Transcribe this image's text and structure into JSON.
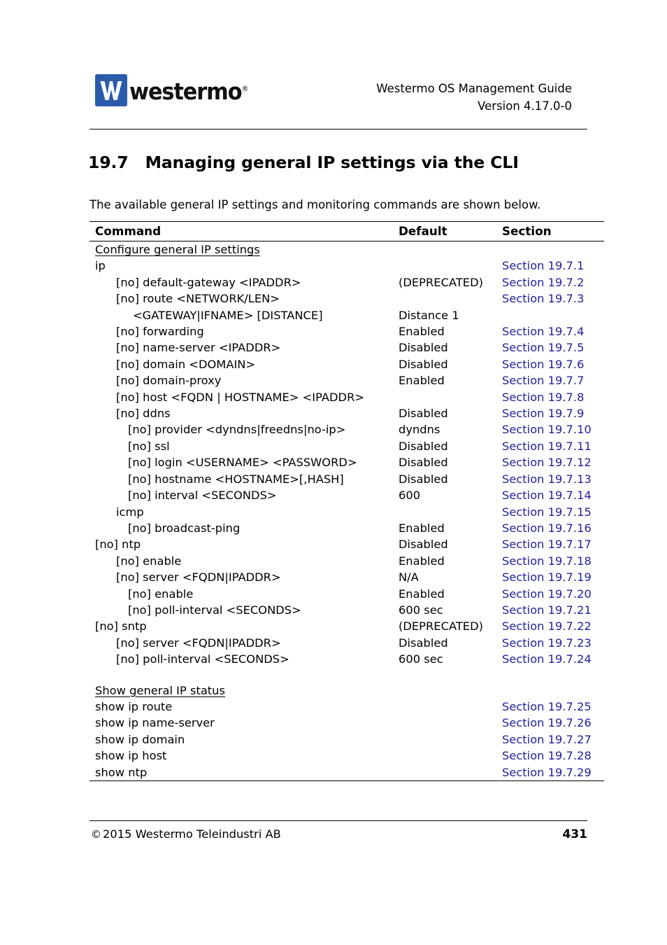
{
  "header": {
    "logo_word": "westermo",
    "logo_reg": "®",
    "doc_title": "Westermo OS Management Guide",
    "doc_version": "Version 4.17.0-0"
  },
  "section": {
    "number": "19.7",
    "title": "Managing general IP settings via the CLI",
    "intro": "The available general IP settings and monitoring commands are shown below."
  },
  "table": {
    "columns": [
      "Command",
      "Default",
      "Section"
    ],
    "groups": [
      {
        "heading": "Configure general IP settings",
        "rows": [
          {
            "level": 0,
            "command": "ip",
            "default": "",
            "section": "Section 19.7.1"
          },
          {
            "level": 1,
            "command": "[no] default-gateway <IPADDR>",
            "default": "(DEPRECATED)",
            "section": "Section 19.7.2"
          },
          {
            "level": 1,
            "command": "[no] route <NETWORK/LEN>",
            "default": "",
            "section": "Section 19.7.3"
          },
          {
            "level": 3,
            "command": "<GATEWAY|IFNAME> [DISTANCE]",
            "default": "Distance 1",
            "section": ""
          },
          {
            "level": 1,
            "command": "[no] forwarding",
            "default": "Enabled",
            "section": "Section 19.7.4"
          },
          {
            "level": 1,
            "command": "[no] name-server <IPADDR>",
            "default": "Disabled",
            "section": "Section 19.7.5"
          },
          {
            "level": 1,
            "command": "[no] domain <DOMAIN>",
            "default": "Disabled",
            "section": "Section 19.7.6"
          },
          {
            "level": 1,
            "command": "[no] domain-proxy",
            "default": "Enabled",
            "section": "Section 19.7.7"
          },
          {
            "level": 1,
            "command": "[no] host <FQDN | HOSTNAME> <IPADDR>",
            "default": "",
            "section": "Section 19.7.8"
          },
          {
            "level": 1,
            "command": "[no] ddns",
            "default": "Disabled",
            "section": "Section 19.7.9"
          },
          {
            "level": 2,
            "command": "[no] provider <dyndns|freedns|no-ip>",
            "default": "dyndns",
            "section": "Section 19.7.10"
          },
          {
            "level": 2,
            "command": "[no] ssl",
            "default": "Disabled",
            "section": "Section 19.7.11"
          },
          {
            "level": 2,
            "command": "[no] login <USERNAME> <PASSWORD>",
            "default": "Disabled",
            "section": "Section 19.7.12"
          },
          {
            "level": 2,
            "command": "[no] hostname <HOSTNAME>[,HASH]",
            "default": "Disabled",
            "section": "Section 19.7.13"
          },
          {
            "level": 2,
            "command": "[no] interval <SECONDS>",
            "default": "600",
            "section": "Section 19.7.14"
          },
          {
            "level": 1,
            "command": "icmp",
            "default": "",
            "section": "Section 19.7.15"
          },
          {
            "level": 2,
            "command": "[no] broadcast-ping",
            "default": "Enabled",
            "section": "Section 19.7.16"
          },
          {
            "level": 0,
            "command": "[no] ntp",
            "default": "Disabled",
            "section": "Section 19.7.17"
          },
          {
            "level": 1,
            "command": "[no] enable",
            "default": "Enabled",
            "section": "Section 19.7.18"
          },
          {
            "level": 1,
            "command": "[no] server <FQDN|IPADDR>",
            "default": "N/A",
            "section": "Section 19.7.19"
          },
          {
            "level": 2,
            "command": "[no] enable",
            "default": "Enabled",
            "section": "Section 19.7.20"
          },
          {
            "level": 2,
            "command": "[no] poll-interval <SECONDS>",
            "default": "600 sec",
            "section": "Section 19.7.21"
          },
          {
            "level": 0,
            "command": "[no] sntp",
            "default": "(DEPRECATED)",
            "section": "Section 19.7.22"
          },
          {
            "level": 1,
            "command": "[no] server <FQDN|IPADDR>",
            "default": "Disabled",
            "section": "Section 19.7.23"
          },
          {
            "level": 1,
            "command": "[no] poll-interval <SECONDS>",
            "default": "600 sec",
            "section": "Section 19.7.24"
          }
        ]
      },
      {
        "heading": "Show general IP status",
        "rows": [
          {
            "level": 0,
            "command": "show ip route",
            "default": "",
            "section": "Section 19.7.25"
          },
          {
            "level": 0,
            "command": "show ip name-server",
            "default": "",
            "section": "Section 19.7.26"
          },
          {
            "level": 0,
            "command": "show ip domain",
            "default": "",
            "section": "Section 19.7.27"
          },
          {
            "level": 0,
            "command": "show ip host",
            "default": "",
            "section": "Section 19.7.28"
          },
          {
            "level": 0,
            "command": "show ntp",
            "default": "",
            "section": "Section 19.7.29"
          }
        ]
      }
    ]
  },
  "footer": {
    "copyright_glyph": "©",
    "copyright": "2015 Westermo Teleindustri AB",
    "page_number": "431"
  },
  "colors": {
    "link": "#21219c",
    "logo_blue": "#2b5cab",
    "text": "#000000"
  }
}
